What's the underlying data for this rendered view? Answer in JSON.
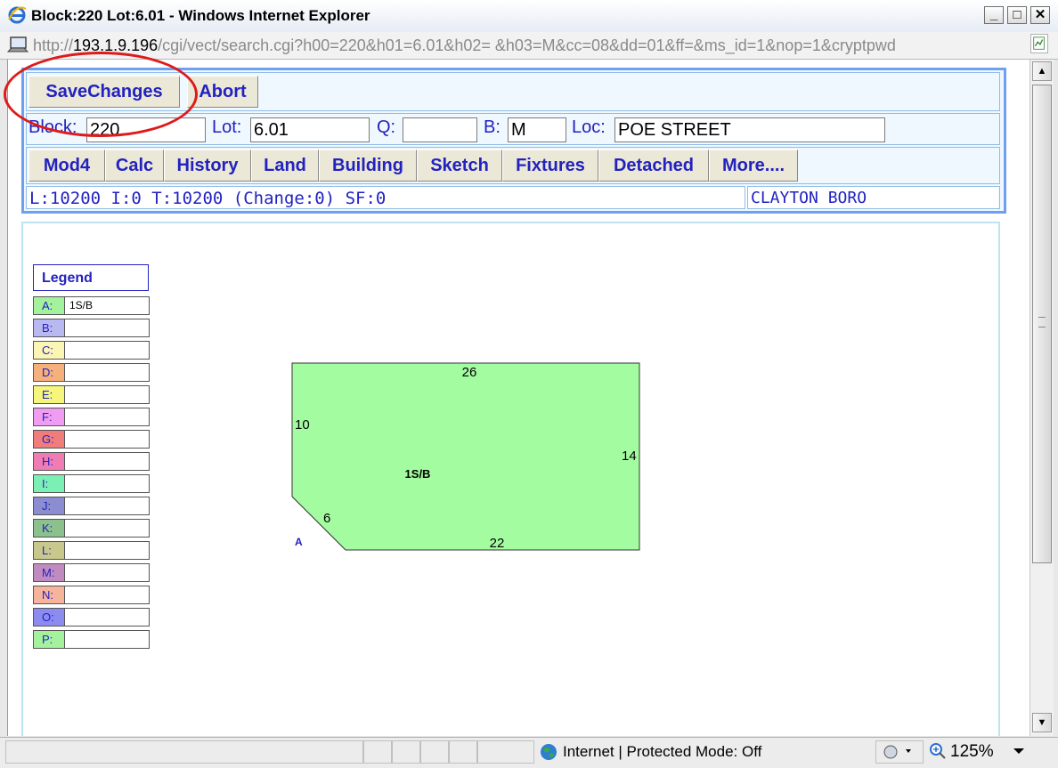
{
  "window": {
    "title": "Block:220 Lot:6.01 - Windows Internet Explorer",
    "minimize": "_",
    "maximize": "□",
    "close": "✕"
  },
  "address": {
    "host": "193.1.9.196",
    "prefix": "http://",
    "path": "/cgi/vect/search.cgi?h00=220&h01=6.01&h02= &h03=M&cc=08&dd=01&ff=&ms_id=1&nop=1&cryptpwd"
  },
  "toolbar": {
    "save_label": "SaveChanges",
    "abort_label": "Abort"
  },
  "fields": {
    "block_label": "Block:",
    "block_value": "220",
    "lot_label": "Lot:",
    "lot_value": "6.01",
    "q_label": "Q:",
    "q_value": "",
    "b_label": "B:",
    "b_value": "M",
    "loc_label": "Loc:",
    "loc_value": "POE STREET"
  },
  "nav": [
    {
      "label": "Mod4"
    },
    {
      "label": "Calc"
    },
    {
      "label": "History"
    },
    {
      "label": "Land"
    },
    {
      "label": "Building"
    },
    {
      "label": "Sketch"
    },
    {
      "label": "Fixtures"
    },
    {
      "label": "Detached"
    },
    {
      "label": "More...."
    }
  ],
  "summary": {
    "values": "L:10200 I:0 T:10200 (Change:0) SF:0",
    "municipality": "CLAYTON BORO"
  },
  "legend": {
    "title": "Legend",
    "items": [
      {
        "key": "A:",
        "value": "1S/B",
        "color": "#a4f29e"
      },
      {
        "key": "B:",
        "value": "",
        "color": "#b9b9f2"
      },
      {
        "key": "C:",
        "value": "",
        "color": "#fcf6b4"
      },
      {
        "key": "D:",
        "value": "",
        "color": "#f6b07c"
      },
      {
        "key": "E:",
        "value": "",
        "color": "#f6f67c"
      },
      {
        "key": "F:",
        "value": "",
        "color": "#f09cf0"
      },
      {
        "key": "G:",
        "value": "",
        "color": "#f07c7c"
      },
      {
        "key": "H:",
        "value": "",
        "color": "#f07cb4"
      },
      {
        "key": "I:",
        "value": "",
        "color": "#7cf0b4"
      },
      {
        "key": "J:",
        "value": "",
        "color": "#8c8cd0"
      },
      {
        "key": "K:",
        "value": "",
        "color": "#8cc08c"
      },
      {
        "key": "L:",
        "value": "",
        "color": "#c8c88c"
      },
      {
        "key": "M:",
        "value": "",
        "color": "#c08cc0"
      },
      {
        "key": "N:",
        "value": "",
        "color": "#f6b49c"
      },
      {
        "key": "O:",
        "value": "",
        "color": "#8c8cf0"
      },
      {
        "key": "P:",
        "value": "",
        "color": "#a4f29e"
      }
    ]
  },
  "sketch": {
    "area_label": "1S/B",
    "corner_label": "A",
    "fill_color": "#a4fca0",
    "dimensions": {
      "top": "26",
      "left": "10",
      "right": "14",
      "diagonal": "6",
      "bottom": "22"
    }
  },
  "status": {
    "zone": "Internet | Protected Mode: Off",
    "zoom": "125%"
  }
}
